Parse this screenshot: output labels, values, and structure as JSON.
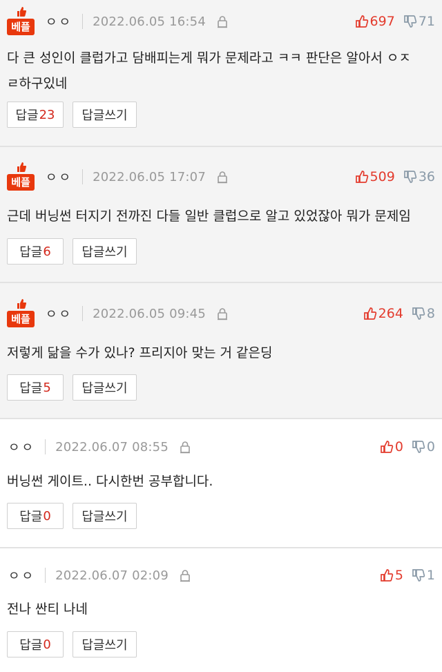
{
  "comments": [
    {
      "best": true,
      "badge": "베플",
      "nick": "ㅇㅇ",
      "date": "2022.06.05 16:54",
      "up": "697",
      "down": "71",
      "body_lines": [
        "다 큰 성인이 클럽가고 담배피는게 뭐가 문제라고 ㅋㅋ 판단은 알아서 ㅇㅈ",
        "ㄹ하구있네"
      ],
      "reply_label": "답글",
      "reply_count": "23",
      "write_label": "답글쓰기"
    },
    {
      "best": true,
      "badge": "베플",
      "nick": "ㅇㅇ",
      "date": "2022.06.05 17:07",
      "up": "509",
      "down": "36",
      "body_lines": [
        "근데 버닝썬 터지기 전까진 다들 일반 클럽으로 알고 있었잖아 뭐가 문제임"
      ],
      "reply_label": "답글",
      "reply_count": "6",
      "write_label": "답글쓰기"
    },
    {
      "best": true,
      "badge": "베플",
      "nick": "ㅇㅇ",
      "date": "2022.06.05 09:45",
      "up": "264",
      "down": "8",
      "body_lines": [
        "저렇게 닮을 수가 있나? 프리지아 맞는 거 같은딩"
      ],
      "reply_label": "답글",
      "reply_count": "5",
      "write_label": "답글쓰기"
    },
    {
      "best": false,
      "nick": "ㅇㅇ",
      "date": "2022.06.07 08:55",
      "up": "0",
      "down": "0",
      "body_lines": [
        "버닝썬 게이트.. 다시한번 공부합니다."
      ],
      "reply_label": "답글",
      "reply_count": "0",
      "write_label": "답글쓰기"
    },
    {
      "best": false,
      "nick": "ㅇㅇ",
      "date": "2022.06.07 02:09",
      "up": "5",
      "down": "1",
      "body_lines": [
        "전나 싼티 나네"
      ],
      "reply_label": "답글",
      "reply_count": "0",
      "write_label": "답글쓰기"
    }
  ],
  "colors": {
    "badge": "#e8380d",
    "up": "#e33b2d",
    "down": "#8a9aa8",
    "reply_count": "#d3281c",
    "best_bg": "#f4f4f4"
  },
  "icons": {
    "badge_icon": "thumbs-up-icon",
    "lock_icon": "lock-icon",
    "up_icon": "thumbs-up-icon",
    "down_icon": "thumbs-down-icon"
  }
}
